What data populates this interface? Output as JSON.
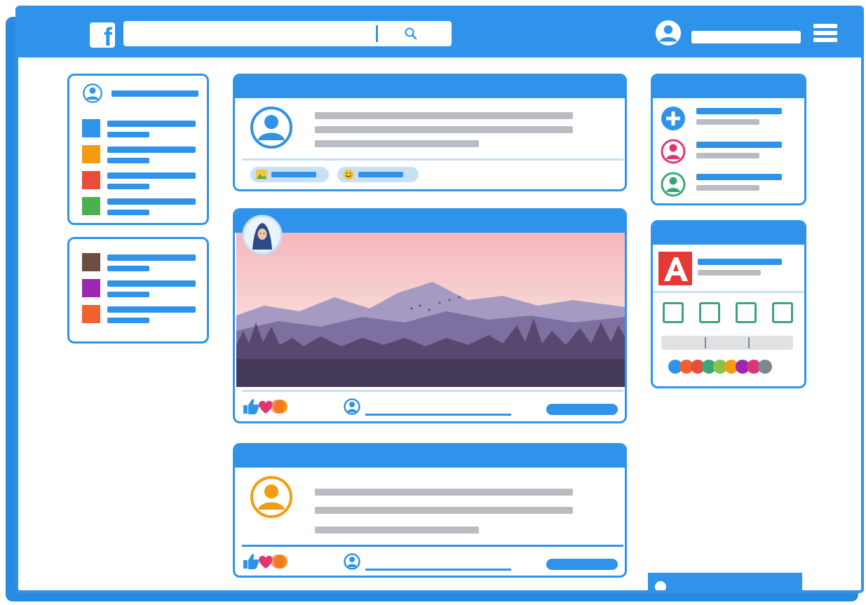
{
  "app": {
    "name": "facebook",
    "logo_letter": "f"
  },
  "icons": {
    "logo": "facebook-logo-icon",
    "search": "search-icon",
    "account": "user-avatar-icon",
    "menu": "hamburger-menu-icon",
    "photo": "photo-icon",
    "emoji": "smile-emoji-icon",
    "add": "plus-circle-icon",
    "like": "thumbs-up-icon",
    "love": "heart-icon",
    "haha": "smile-reaction-icon",
    "app_tile": "letter-a-app-icon"
  },
  "colors": {
    "brand": "#2f93ea",
    "bar_gray": "#b9bcc0",
    "sidebar_squares": [
      "#2f93ea",
      "#f39c12",
      "#e74c3c",
      "#4caf50",
      "#6d4c41",
      "#9c27b0",
      "#f0622d"
    ],
    "suggestion_colors": [
      "#2f93ea",
      "#e0366f",
      "#3aa874"
    ],
    "post_avatars": [
      "#2f93ea",
      "#f39c12"
    ],
    "app_tile": "#e53935",
    "palette_dots": [
      "#2f93ea",
      "#f0622d",
      "#e74c3c",
      "#3aa874",
      "#8bc34a",
      "#f39c12",
      "#9c27b0",
      "#e0366f",
      "#7d8790"
    ]
  }
}
